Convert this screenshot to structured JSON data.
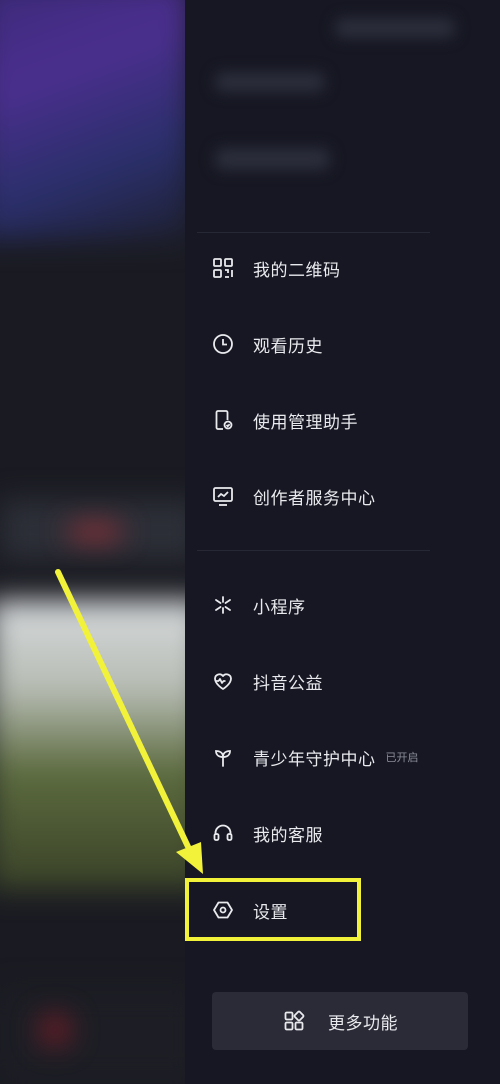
{
  "menu": {
    "items": [
      {
        "key": "qrcode",
        "label": "我的二维码",
        "icon": "qr-code-icon"
      },
      {
        "key": "history",
        "label": "观看历史",
        "icon": "clock-icon"
      },
      {
        "key": "usage",
        "label": "使用管理助手",
        "icon": "phone-check-icon"
      },
      {
        "key": "creator",
        "label": "创作者服务中心",
        "icon": "chart-monitor-icon"
      },
      {
        "key": "miniapp",
        "label": "小程序",
        "icon": "asterisk-icon"
      },
      {
        "key": "charity",
        "label": "抖音公益",
        "icon": "heart-pulse-icon"
      },
      {
        "key": "youth",
        "label": "青少年守护中心",
        "badge": "已开启",
        "icon": "sprout-icon"
      },
      {
        "key": "service",
        "label": "我的客服",
        "icon": "headset-icon"
      },
      {
        "key": "settings",
        "label": "设置",
        "icon": "hexagon-gear-icon"
      }
    ]
  },
  "more": {
    "label": "更多功能",
    "icon": "grid-icon"
  },
  "annotation": {
    "color": "#f2f23a"
  },
  "colors": {
    "drawer_bg": "#161722",
    "text": "#e9eaee",
    "muted": "#8b8d99"
  }
}
